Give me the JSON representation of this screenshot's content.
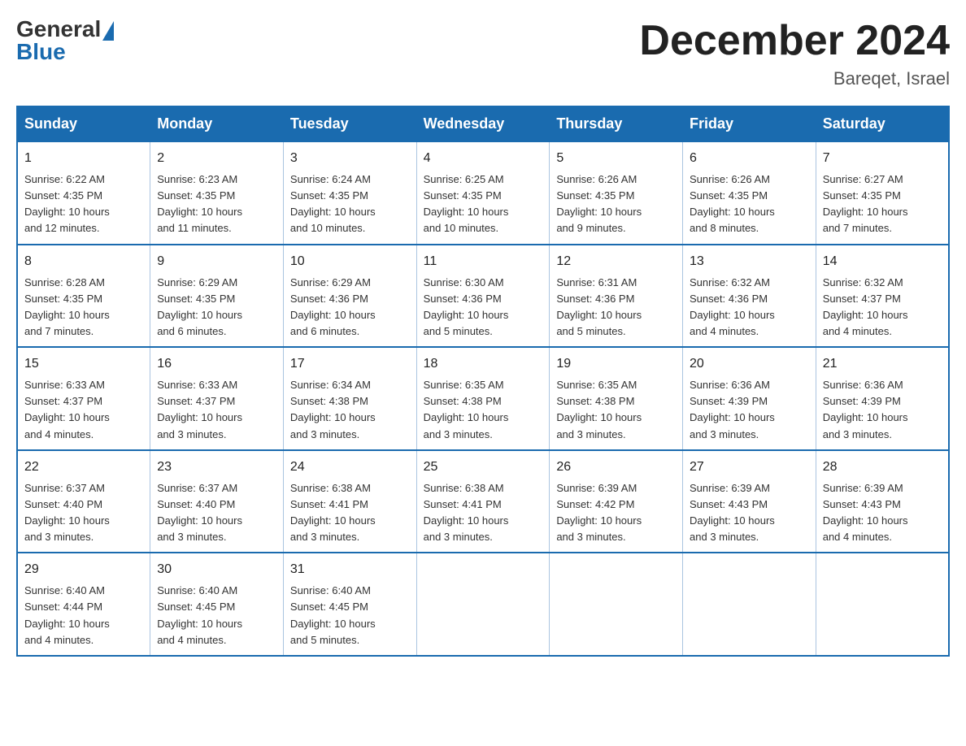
{
  "header": {
    "logo_general": "General",
    "logo_blue": "Blue",
    "month_title": "December 2024",
    "location": "Bareqet, Israel"
  },
  "weekdays": [
    "Sunday",
    "Monday",
    "Tuesday",
    "Wednesday",
    "Thursday",
    "Friday",
    "Saturday"
  ],
  "weeks": [
    [
      {
        "day": "1",
        "sunrise": "6:22 AM",
        "sunset": "4:35 PM",
        "daylight": "10 hours and 12 minutes."
      },
      {
        "day": "2",
        "sunrise": "6:23 AM",
        "sunset": "4:35 PM",
        "daylight": "10 hours and 11 minutes."
      },
      {
        "day": "3",
        "sunrise": "6:24 AM",
        "sunset": "4:35 PM",
        "daylight": "10 hours and 10 minutes."
      },
      {
        "day": "4",
        "sunrise": "6:25 AM",
        "sunset": "4:35 PM",
        "daylight": "10 hours and 10 minutes."
      },
      {
        "day": "5",
        "sunrise": "6:26 AM",
        "sunset": "4:35 PM",
        "daylight": "10 hours and 9 minutes."
      },
      {
        "day": "6",
        "sunrise": "6:26 AM",
        "sunset": "4:35 PM",
        "daylight": "10 hours and 8 minutes."
      },
      {
        "day": "7",
        "sunrise": "6:27 AM",
        "sunset": "4:35 PM",
        "daylight": "10 hours and 7 minutes."
      }
    ],
    [
      {
        "day": "8",
        "sunrise": "6:28 AM",
        "sunset": "4:35 PM",
        "daylight": "10 hours and 7 minutes."
      },
      {
        "day": "9",
        "sunrise": "6:29 AM",
        "sunset": "4:35 PM",
        "daylight": "10 hours and 6 minutes."
      },
      {
        "day": "10",
        "sunrise": "6:29 AM",
        "sunset": "4:36 PM",
        "daylight": "10 hours and 6 minutes."
      },
      {
        "day": "11",
        "sunrise": "6:30 AM",
        "sunset": "4:36 PM",
        "daylight": "10 hours and 5 minutes."
      },
      {
        "day": "12",
        "sunrise": "6:31 AM",
        "sunset": "4:36 PM",
        "daylight": "10 hours and 5 minutes."
      },
      {
        "day": "13",
        "sunrise": "6:32 AM",
        "sunset": "4:36 PM",
        "daylight": "10 hours and 4 minutes."
      },
      {
        "day": "14",
        "sunrise": "6:32 AM",
        "sunset": "4:37 PM",
        "daylight": "10 hours and 4 minutes."
      }
    ],
    [
      {
        "day": "15",
        "sunrise": "6:33 AM",
        "sunset": "4:37 PM",
        "daylight": "10 hours and 4 minutes."
      },
      {
        "day": "16",
        "sunrise": "6:33 AM",
        "sunset": "4:37 PM",
        "daylight": "10 hours and 3 minutes."
      },
      {
        "day": "17",
        "sunrise": "6:34 AM",
        "sunset": "4:38 PM",
        "daylight": "10 hours and 3 minutes."
      },
      {
        "day": "18",
        "sunrise": "6:35 AM",
        "sunset": "4:38 PM",
        "daylight": "10 hours and 3 minutes."
      },
      {
        "day": "19",
        "sunrise": "6:35 AM",
        "sunset": "4:38 PM",
        "daylight": "10 hours and 3 minutes."
      },
      {
        "day": "20",
        "sunrise": "6:36 AM",
        "sunset": "4:39 PM",
        "daylight": "10 hours and 3 minutes."
      },
      {
        "day": "21",
        "sunrise": "6:36 AM",
        "sunset": "4:39 PM",
        "daylight": "10 hours and 3 minutes."
      }
    ],
    [
      {
        "day": "22",
        "sunrise": "6:37 AM",
        "sunset": "4:40 PM",
        "daylight": "10 hours and 3 minutes."
      },
      {
        "day": "23",
        "sunrise": "6:37 AM",
        "sunset": "4:40 PM",
        "daylight": "10 hours and 3 minutes."
      },
      {
        "day": "24",
        "sunrise": "6:38 AM",
        "sunset": "4:41 PM",
        "daylight": "10 hours and 3 minutes."
      },
      {
        "day": "25",
        "sunrise": "6:38 AM",
        "sunset": "4:41 PM",
        "daylight": "10 hours and 3 minutes."
      },
      {
        "day": "26",
        "sunrise": "6:39 AM",
        "sunset": "4:42 PM",
        "daylight": "10 hours and 3 minutes."
      },
      {
        "day": "27",
        "sunrise": "6:39 AM",
        "sunset": "4:43 PM",
        "daylight": "10 hours and 3 minutes."
      },
      {
        "day": "28",
        "sunrise": "6:39 AM",
        "sunset": "4:43 PM",
        "daylight": "10 hours and 4 minutes."
      }
    ],
    [
      {
        "day": "29",
        "sunrise": "6:40 AM",
        "sunset": "4:44 PM",
        "daylight": "10 hours and 4 minutes."
      },
      {
        "day": "30",
        "sunrise": "6:40 AM",
        "sunset": "4:45 PM",
        "daylight": "10 hours and 4 minutes."
      },
      {
        "day": "31",
        "sunrise": "6:40 AM",
        "sunset": "4:45 PM",
        "daylight": "10 hours and 5 minutes."
      },
      null,
      null,
      null,
      null
    ]
  ],
  "labels": {
    "sunrise": "Sunrise:",
    "sunset": "Sunset:",
    "daylight": "Daylight:"
  }
}
